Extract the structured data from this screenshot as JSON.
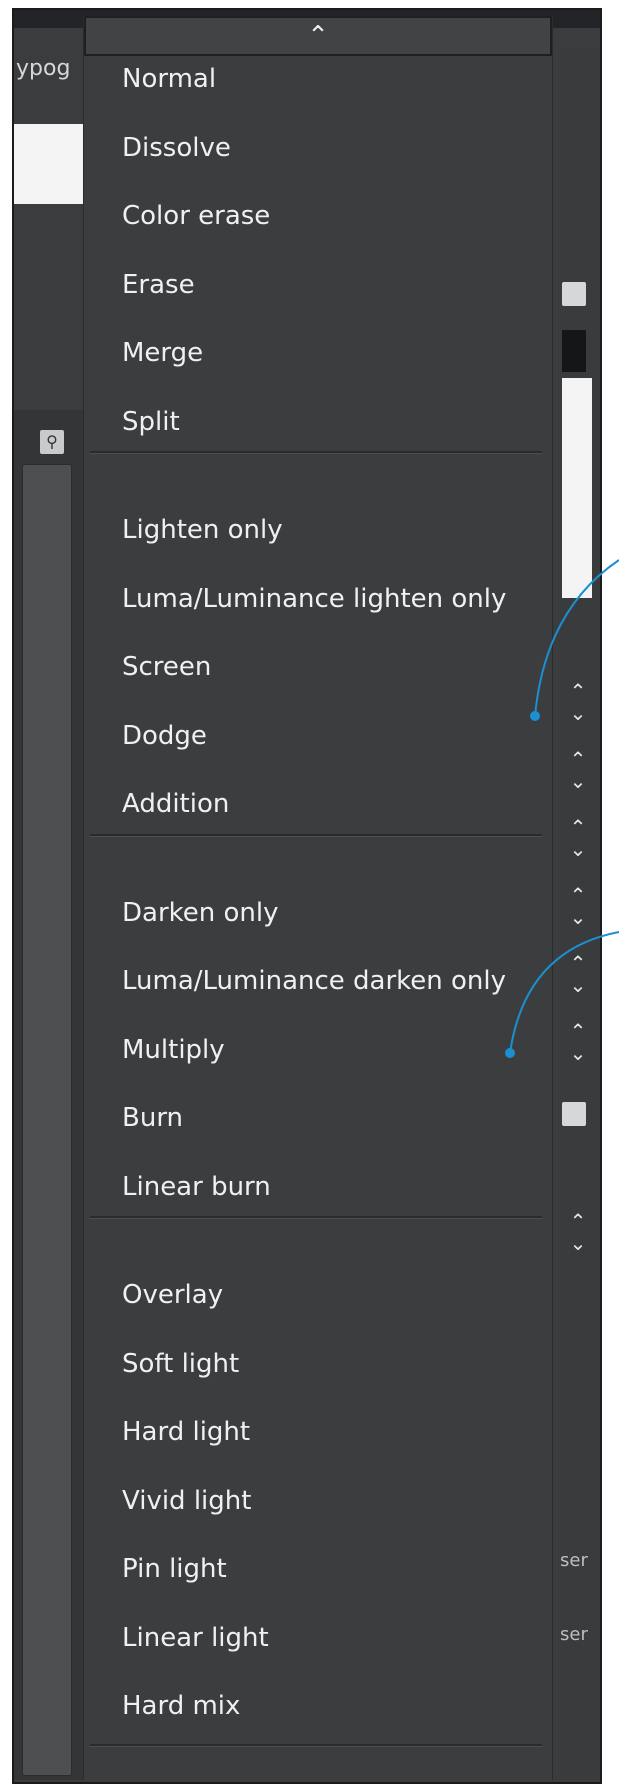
{
  "top_text": "ypog",
  "menu": {
    "scroll_up_icon": "chevron-up-icon",
    "groups": [
      [
        "Normal",
        "Dissolve",
        "Color erase",
        "Erase",
        "Merge",
        "Split"
      ],
      [
        "Lighten only",
        "Luma/Luminance lighten only",
        "Screen",
        "Dodge",
        "Addition"
      ],
      [
        "Darken only",
        "Luma/Luminance darken only",
        "Multiply",
        "Burn",
        "Linear burn"
      ],
      [
        "Overlay",
        "Soft light",
        "Hard light",
        "Vivid light",
        "Pin light",
        "Linear light",
        "Hard mix"
      ]
    ]
  },
  "right_panel": {
    "cut_text_1": "ser",
    "cut_text_2": "ser"
  },
  "colors": {
    "background": "#3c3d3f",
    "text": "#f0f0f0",
    "callout": "#1a8fd1"
  }
}
